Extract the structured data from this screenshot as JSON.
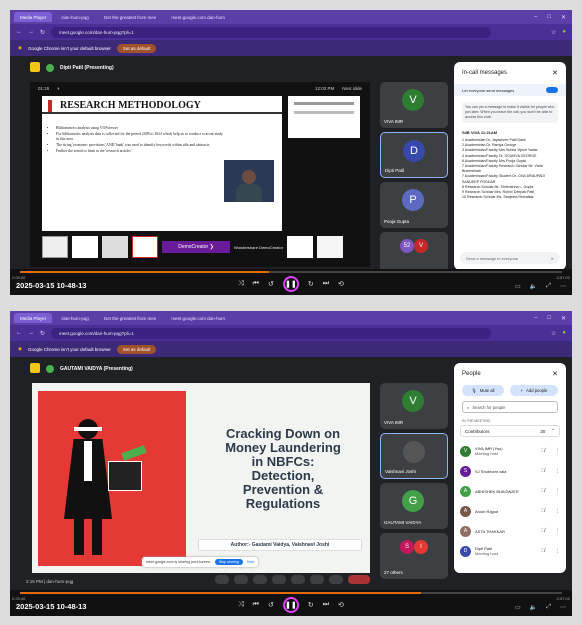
{
  "frames": [
    {
      "tabs": [
        "Media Player",
        "clan-hum-pqg",
        "Get the greatest from mee",
        "meet.google.com dan-hum"
      ],
      "url": "meet.google.com/dan-hum-pqg?pli=1",
      "infobar_text": "Google Chrome isn't your default browser",
      "set_default_label": "Set as default",
      "presenter": "Dipti Patil (Presenting)",
      "slide": {
        "title": "RESEARCH METHODOLOGY",
        "bullets": [
          "Bibliometrics analysis using VOSviewer",
          "For bibliometric analysis data is collected for the period 2008 to 2023 which help us to conduct a recent study in this area.",
          "The string 'economic provisions' AND 'bank' was used to identify keywords within title and abstracts",
          "Further the search is limit to the 'research articles'"
        ],
        "slide_time": "12:03 PM",
        "next_label": "Next slide",
        "counter": "01:26"
      },
      "watermark": "Wondershare DemoCreator",
      "tiles": [
        {
          "initial": "V",
          "name": "VIVA IMR",
          "color": "#2e7d32"
        },
        {
          "initial": "D",
          "name": "Dipti Patil",
          "color": "#3949ab"
        },
        {
          "initial": "P",
          "name": "Pooja Gupta",
          "color": "#5c6bc0"
        },
        {
          "initial": "52",
          "name": "23 others",
          "color": "#7e57c2"
        }
      ],
      "chat": {
        "title": "In-call messages",
        "toggle_label": "Let everyone send messages",
        "info": "You can pin a message to make it visible for people who join later. When you leave the call, you won't be able to access this chat.",
        "messages_header": "SIIB VIVA 11:21AM",
        "messages": [
          "1 Academician Dr. Jayashree Patil Dake",
          "2 Academician Dr. Ramya George",
          "3 Academician/Faculty Mrs.Sunita Vijesh Yadav",
          "4 Academician/Faculty Dr. SOUMYA GEORGE",
          "6 Academician/Faculty Mrs.Pooja Gupta",
          "7 Academician/Faculty Research Scholar Mr. Vivek Brahmbhatt",
          "7 Academician/Faculty Student Dr. CMA DRAUPADI SANDEEP PODDAR",
          "8 Research Scholar Mr. Shrikrishna L. Gupta",
          "9 Research Scholar Mrs. Rohini Deepak Patil",
          "10 Research Scholar Ms. Sanjeeta Rewatkar"
        ],
        "input_placeholder": "Send a message to everyone"
      },
      "bottom_time": "12:03 PM | dan-hum-pqg",
      "tl_left": "2:09:00",
      "tl_right": "2:57:02",
      "progress": 0.46,
      "datetime": "2025-03-15 10-48-13"
    },
    {
      "tabs": [
        "Media Player",
        "clan-hum-pqg",
        "Get the greatest from mee",
        "meet.google.com dan-hum"
      ],
      "url": "meet.google.com/dan-hum-pqg?pli=1",
      "infobar_text": "Google Chrome isn't your default browser",
      "set_default_label": "Set as default",
      "presenter": "GAUTAMI VAIDYA (Presenting)",
      "slide": {
        "title_lines": [
          "Cracking Down on",
          "Money Laundering",
          "in NBFCs:",
          "Detection,",
          "Prevention &",
          "Regulations"
        ],
        "author": "Author:- Gautami Vaidya, Vaishnavi Joshi",
        "share_text": "meet.google.com is sharing your screen.",
        "stop_sharing": "Stop sharing",
        "hide": "Hide"
      },
      "tiles": [
        {
          "initial": "V",
          "name": "VIVA IMR",
          "color": "#2e7d32"
        },
        {
          "initial": "",
          "name": "Vaishnavi Joshi",
          "color": "#555"
        },
        {
          "initial": "G",
          "name": "GAUTAMI VAIDYA",
          "color": "#43a047"
        },
        {
          "initial": "S",
          "name": "27 others",
          "color": "#c2185b"
        }
      ],
      "people": {
        "title": "People",
        "mute_all": "Mute all",
        "add_people": "Add people",
        "search_placeholder": "Search for people",
        "section": "IN THE MEETING",
        "contributors_label": "Contributors",
        "contributors_count": "30",
        "list": [
          {
            "name": "VIVA IMR (You)",
            "sub": "Meeting host",
            "color": "#2e7d32",
            "initial": "V"
          },
          {
            "name": "SJ Shubham vala",
            "sub": "",
            "color": "#6a1b9a",
            "initial": "S"
          },
          {
            "name": "ABHISHEK BHAGWATE",
            "sub": "",
            "color": "#43a047",
            "initial": "A"
          },
          {
            "name": "Arush Rajput",
            "sub": "",
            "color": "#795548",
            "initial": "A"
          },
          {
            "name": "ASTA THAKKAR",
            "sub": "",
            "color": "#8d6e63",
            "initial": "A"
          },
          {
            "name": "Dipti Patil",
            "sub": "Meeting host",
            "color": "#3949ab",
            "initial": "D"
          }
        ]
      },
      "bottom_time": "2:15 PM | dan-hum-pqg",
      "tl_left": "2:25:40",
      "tl_right": "2:57:02",
      "progress": 0.74,
      "datetime": "2025-03-15 10-48-13"
    }
  ],
  "colors": {
    "accent": "#1a73e8",
    "timeline": "#e36b00",
    "slide_red": "#e53935"
  }
}
